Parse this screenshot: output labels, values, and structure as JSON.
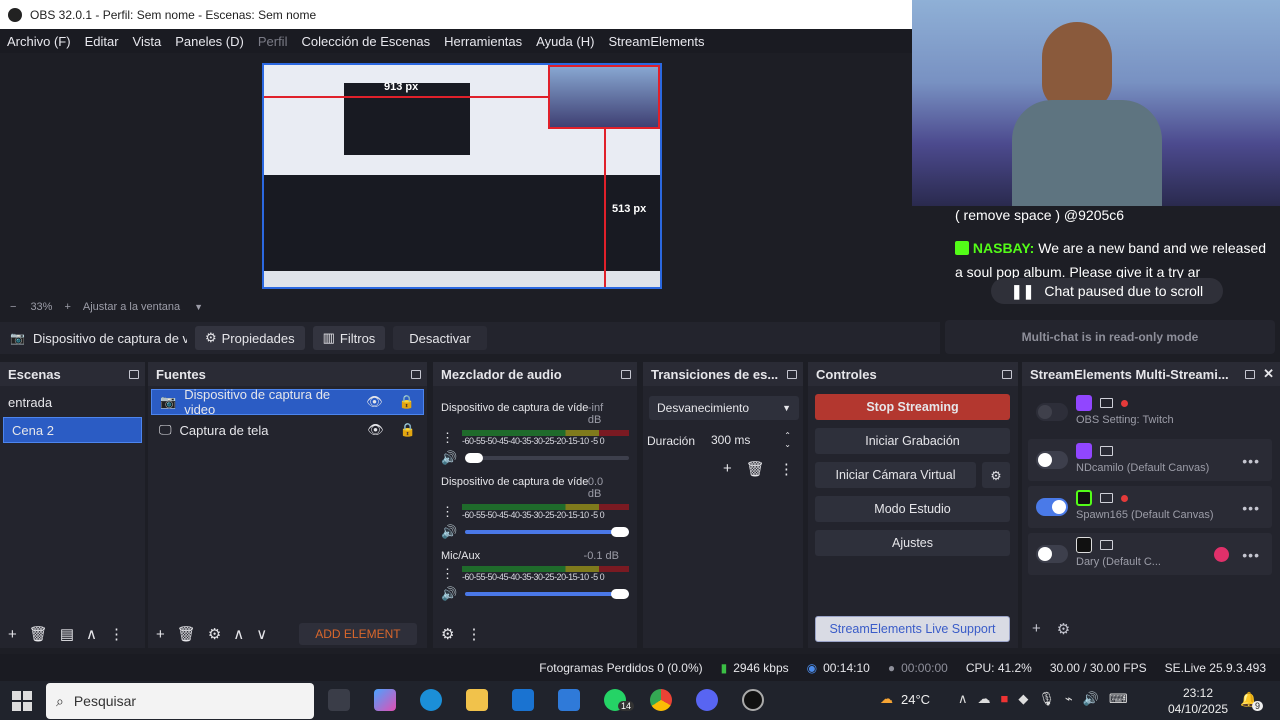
{
  "window": {
    "title": "OBS 32.0.1 - Perfil: Sem nome - Escenas: Sem nome"
  },
  "menu": [
    "Archivo (F)",
    "Editar",
    "Vista",
    "Paneles (D)",
    "Perfil",
    "Colección de Escenas",
    "Herramientas",
    "Ayuda (H)",
    "StreamElements"
  ],
  "preview": {
    "overlay_px_top": "913 px",
    "overlay_px_right": "513 px"
  },
  "zoom": {
    "minus": "−",
    "value": "33%",
    "plus": "+",
    "fit": "Ajustar a la ventana"
  },
  "sourcebar": {
    "source": "Dispositivo de captura de v",
    "properties": "Propiedades",
    "filters": "Filtros",
    "deactivate": "Desactivar"
  },
  "scenes": {
    "title": "Escenas",
    "items": [
      "entrada",
      "Cena 2"
    ]
  },
  "sources": {
    "title": "Fuentes",
    "items": [
      "Dispositivo de captura de video",
      "Captura de tela"
    ],
    "add_element": "ADD ELEMENT"
  },
  "mixer": {
    "title": "Mezclador de audio",
    "ticks": "-60-55-50-45-40-35-30-25-20-15-10 -5  0",
    "channels": [
      {
        "name": "Dispositivo de captura de víde",
        "db": "-inf dB",
        "volume": 0.05
      },
      {
        "name": "Dispositivo de captura de víde",
        "db": "0.0 dB",
        "volume": 1.0
      },
      {
        "name": "Mic/Aux",
        "db": "-0.1 dB",
        "volume": 1.0
      }
    ]
  },
  "transitions": {
    "title": "Transiciones de es...",
    "selected": "Desvanecimiento",
    "duration_label": "Duración",
    "duration_value": "300 ms"
  },
  "controls": {
    "title": "Controles",
    "stop_streaming": "Stop Streaming",
    "start_recording": "Iniciar Grabación",
    "virtual_cam": "Iniciar Cámara Virtual",
    "studio_mode": "Modo Estudio",
    "settings": "Ajustes",
    "support": "StreamElements Live Support"
  },
  "multistream": {
    "title": "StreamElements Multi-Streami...",
    "rows": [
      {
        "label": "OBS Setting: Twitch",
        "on": false
      },
      {
        "label": "NDcamilo (Default Canvas)",
        "on": false
      },
      {
        "label": "Spawn165 (Default Canvas)",
        "on": true
      },
      {
        "label": "Dary (Default C...",
        "on": false
      }
    ]
  },
  "chat": {
    "line1": "( remove space ) @9205c6",
    "user": "NASBAY:",
    "message": "We are a new band and we released a soul pop album. Please give it a try ar",
    "paused": "Chat paused due to scroll",
    "readonly": "Multi-chat is in read-only mode"
  },
  "status": {
    "dropped": "Fotogramas Perdidos 0 (0.0%)",
    "bitrate": "2946 kbps",
    "stream_time": "00:14:10",
    "rec_time": "00:00:00",
    "cpu": "CPU: 41.2%",
    "fps": "30.00 / 30.00 FPS",
    "version": "SE.Live 25.9.3.493"
  },
  "taskbar": {
    "search": "Pesquisar",
    "weather": "24°C",
    "time": "23:12",
    "date": "04/10/2025",
    "whatsapp_badge": "14",
    "notif_badge": "9"
  },
  "colors": {
    "accent": "#2b5cc4",
    "stop": "#b3372f",
    "twitch": "#9146ff",
    "kick": "#53fc18"
  }
}
